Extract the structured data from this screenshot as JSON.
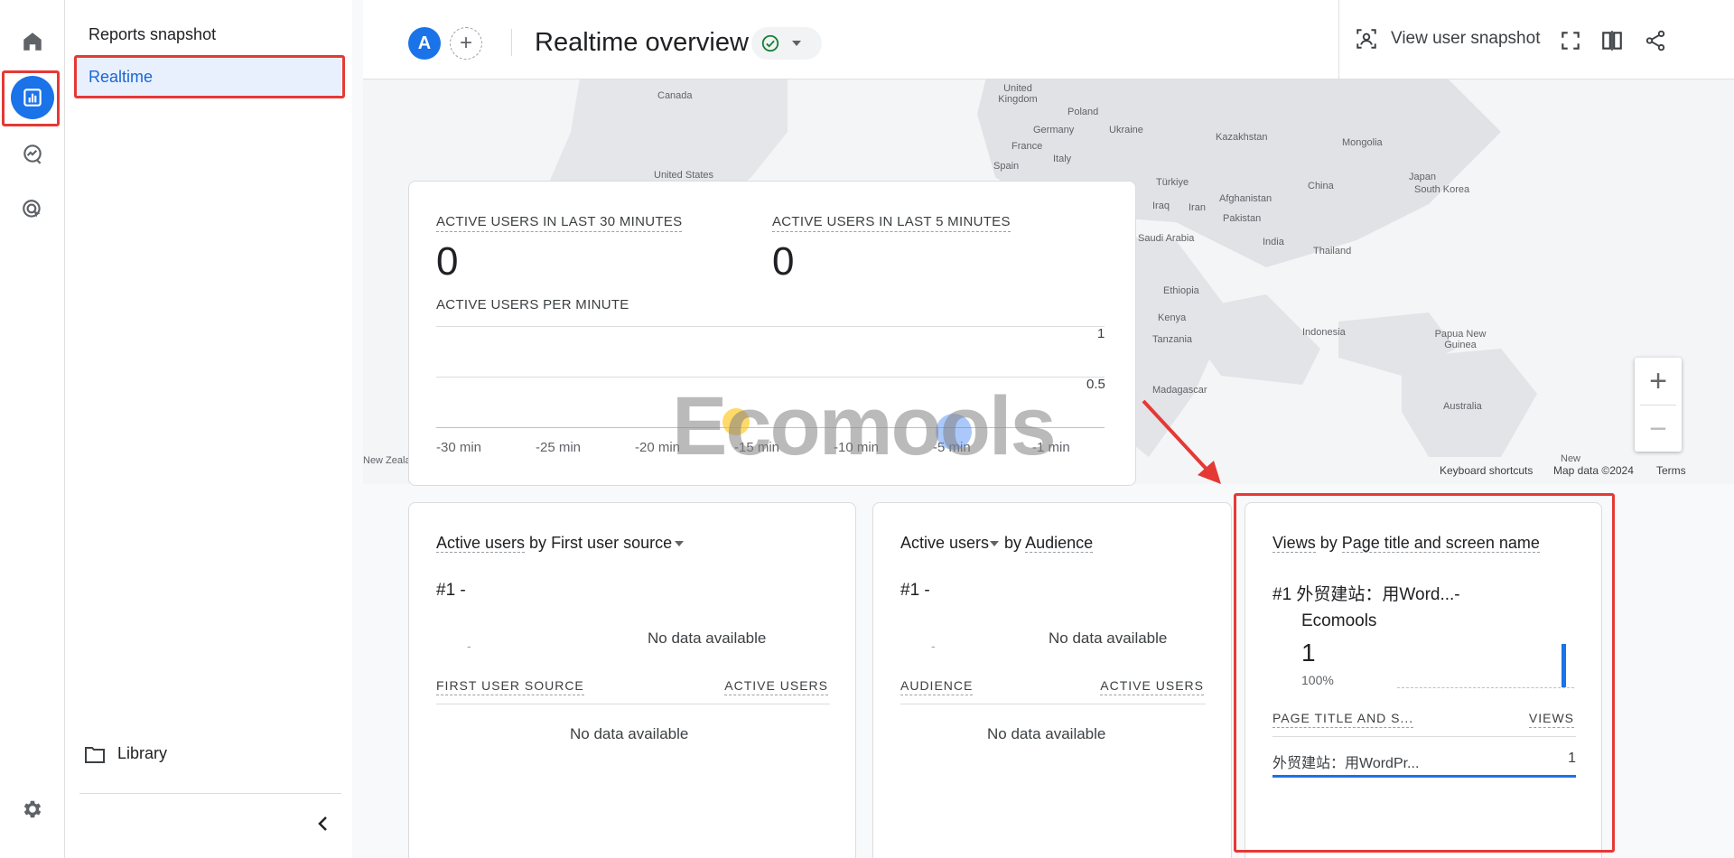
{
  "nav": {
    "section_title": "Reports snapshot",
    "active_item": "Realtime",
    "library": "Library"
  },
  "header": {
    "property_initial": "A",
    "add_comparison": "+",
    "title": "Realtime overview",
    "snapshot_button": "View user snapshot"
  },
  "map": {
    "labels": [
      "Canada",
      "United States",
      "United Kingdom",
      "Poland",
      "Germany",
      "Ukraine",
      "France",
      "Italy",
      "Spain",
      "Kazakhstan",
      "Mongolia",
      "Türkiye",
      "Iraq",
      "Iran",
      "Afghanistan",
      "Pakistan",
      "China",
      "Japan",
      "South Korea",
      "India",
      "Thailand",
      "Saudi Arabia",
      "Ethiopia",
      "Kenya",
      "Tanzania",
      "Madagascar",
      "Indonesia",
      "Papua New Guinea",
      "Australia",
      "New Zealand",
      "New"
    ],
    "keyboard_shortcuts": "Keyboard shortcuts",
    "map_data": "Map data ©2024",
    "terms": "Terms",
    "zoom_in": "+",
    "zoom_out": "−"
  },
  "active_card": {
    "label_30": "ACTIVE USERS IN LAST 30 MINUTES",
    "value_30": "0",
    "label_5": "ACTIVE USERS IN LAST 5 MINUTES",
    "value_5": "0",
    "per_minute_label": "ACTIVE USERS PER MINUTE",
    "y_ticks": [
      "1",
      "0.5"
    ],
    "x_ticks": [
      "-30 min",
      "-25 min",
      "-20 min",
      "-15 min",
      "-10 min",
      "-5 min",
      "-1 min"
    ]
  },
  "source_card": {
    "title_metric": "Active users",
    "title_by": " by ",
    "title_dim": "First user source",
    "rank": "#1  -",
    "dash": "-",
    "no_data": "No data available",
    "col1": "FIRST USER SOURCE",
    "col2": "ACTIVE USERS",
    "table_no_data": "No data available"
  },
  "audience_card": {
    "title_metric": "Active users",
    "title_by": " by ",
    "title_dim": "Audience",
    "rank": "#1  -",
    "dash": "-",
    "no_data": "No data available",
    "col1": "AUDIENCE",
    "col2": "ACTIVE USERS",
    "table_no_data": "No data available"
  },
  "views_card": {
    "title_metric": "Views",
    "title_by": " by ",
    "title_dim": "Page title and screen name",
    "rank_line1": "#1 外贸建站：用Word...-",
    "rank_line2": "Ecomools",
    "value": "1",
    "percent": "100%",
    "bar_fraction": 1.0,
    "col1": "PAGE TITLE AND S...",
    "col2": "VIEWS",
    "row_label": "外贸建站：用WordPr...",
    "row_value": "1"
  },
  "watermark": "Ecomools",
  "colors": {
    "accent": "#1a73e8",
    "highlight": "#e53935",
    "success": "#188038"
  }
}
